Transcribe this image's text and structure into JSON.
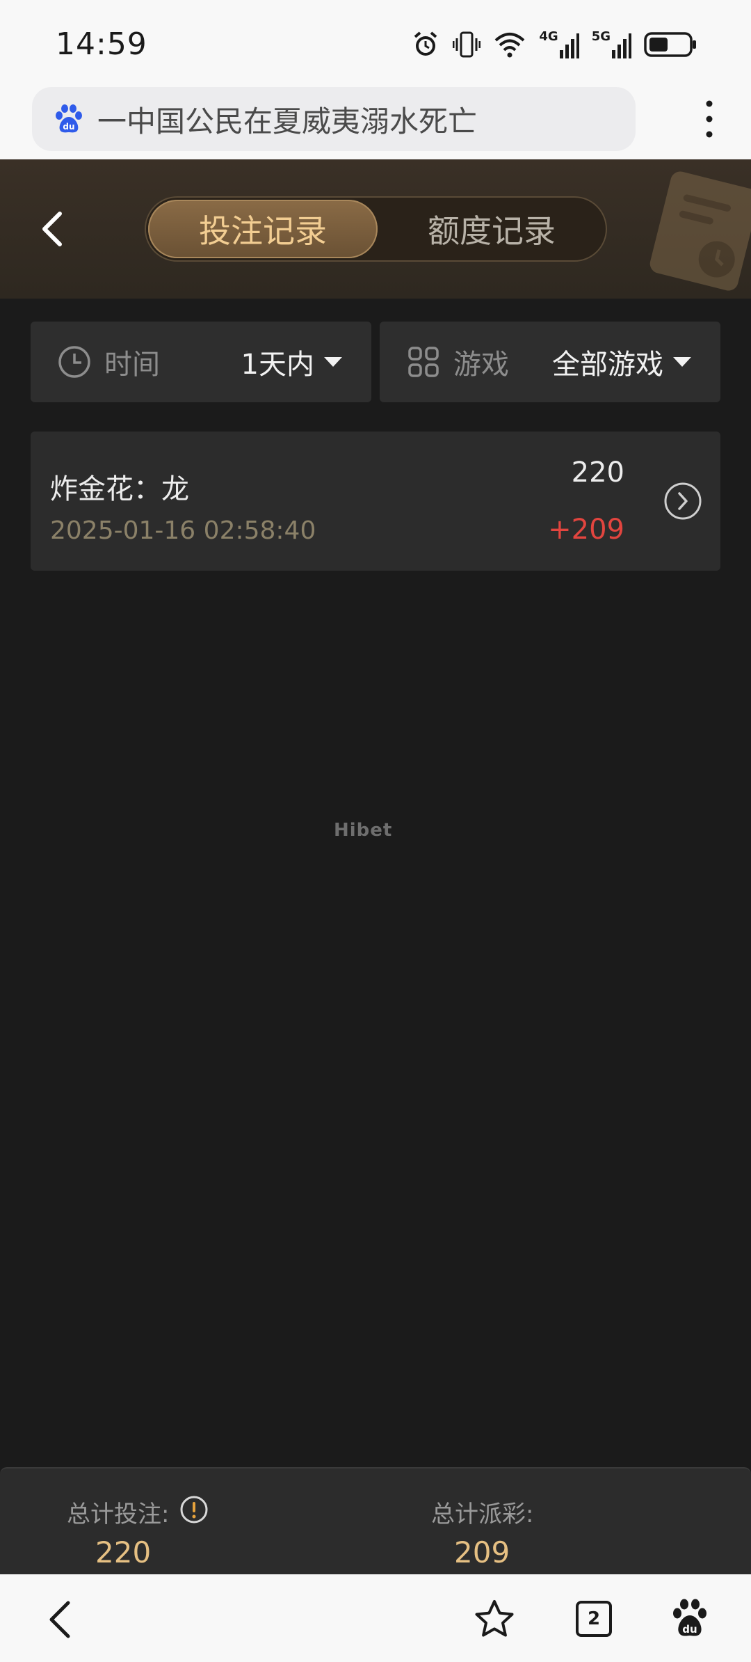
{
  "status_bar": {
    "time": "14:59",
    "network_4g": "4G",
    "network_5g": "5G"
  },
  "browser": {
    "url_text": "一中国公民在夏威夷溺水死亡"
  },
  "header": {
    "tabs": [
      {
        "label": "投注记录",
        "active": true
      },
      {
        "label": "额度记录",
        "active": false
      }
    ]
  },
  "filters": {
    "time": {
      "label": "时间",
      "value": "1天内"
    },
    "game": {
      "label": "游戏",
      "value": "全部游戏"
    }
  },
  "records": [
    {
      "title": "炸金花：龙",
      "datetime": "2025-01-16 02:58:40",
      "bet": "220",
      "payout": "+209"
    }
  ],
  "watermark": "Hibet",
  "summary": {
    "total_bet_label": "总计投注:",
    "total_bet_value": "220",
    "total_payout_label": "总计派彩:",
    "total_payout_value": "209"
  },
  "bottom_nav": {
    "tab_count": "2"
  },
  "colors": {
    "accent_gold": "#e6c083",
    "loss_red": "#e2453f",
    "background": "#1b1b1b"
  }
}
